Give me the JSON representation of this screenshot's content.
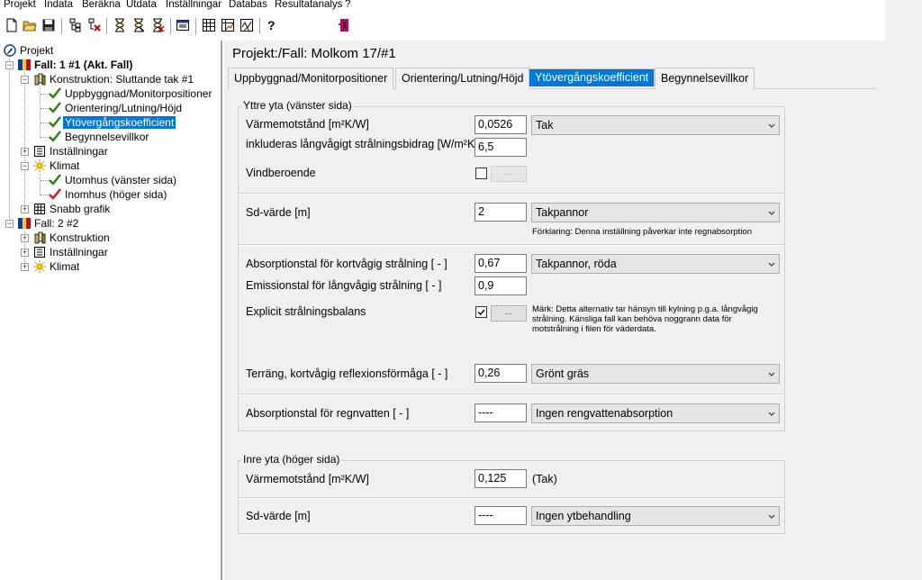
{
  "menu": [
    "Projekt",
    "Indata",
    "Beräkna",
    "Utdata",
    "Inställningar",
    "Databas",
    "Resultatanalys",
    "?"
  ],
  "toolbar": {
    "help_label": "?"
  },
  "tree": {
    "root": "Projekt",
    "case1": "Fall: 1 #1 (Akt. Fall)",
    "construction1": "Konstruktion: Sluttande tak #1",
    "construction1_items": [
      "Uppbyggnad/Monitorpositioner",
      "Orientering/Lutning/Höjd",
      "Ytövergångskoefficient",
      "Begynnelsevillkor"
    ],
    "settings1": "Inställningar",
    "climate1": "Klimat",
    "climate1_items": [
      "Utomhus (vänster sida)",
      "Inomhus (höger sida)"
    ],
    "quick_graph": "Snabb grafik",
    "case2": "Fall: 2 #2",
    "construction2": "Konstruktion",
    "settings2": "Inställningar",
    "climate2": "Klimat"
  },
  "pane": {
    "title": "Projekt:/Fall:  Molkom 17/#1",
    "tabs": [
      "Uppbyggnad/Monitorpositioner",
      "Orientering/Lutning/Höjd",
      "Ytövergångskoefficient",
      "Begynnelsevillkor"
    ]
  },
  "outer": {
    "group_label": "Yttre yta (vänster sida)",
    "thermal_resistance_label": "Värmemotstånd [m²K/W]",
    "thermal_resistance_value": "0,0526",
    "thermal_resistance_combo": "Tak",
    "longwave_label": "inkluderas långvågigt strålningsbidrag [W/m²K]",
    "longwave_value": "6,5",
    "wind_label": "Vindberoende",
    "wind_button": "...",
    "sd_label": "Sd-värde  [m]",
    "sd_value": "2",
    "sd_combo": "Takpannor",
    "sd_note": "Förklaring: Denna inställning påverkar inte regnabsorption",
    "absorption_label": "Absorptionstal för kortvågig strålning [ - ]",
    "absorption_value": "0,67",
    "absorption_combo": "Takpannor, röda",
    "emission_label": "Emissionstal för långvågig strålning [ - ]",
    "emission_value": "0,9",
    "explicit_label": "Explicit strålningsbalans",
    "explicit_button": "...",
    "explicit_note": "Märk: Detta alternativ tar hänsyn till kylning p.g.a. långvågig strålning. Känsliga fall kan behöva noggrann data för motstrålning i filen för väderdata.",
    "terrain_label": "Terräng, kortvågig reflexionsförmåga [ - ]",
    "terrain_value": "0,26",
    "terrain_combo": "Grönt gräs",
    "rain_label": "Absorptionstal för regnvatten [ - ]",
    "rain_value": "----",
    "rain_combo": "Ingen rengvattenabsorption"
  },
  "inner": {
    "group_label": "Inre yta (höger sida)",
    "thermal_resistance_label": "Värmemotstånd [m²K/W]",
    "thermal_resistance_value": "0,125",
    "thermal_resistance_text": "(Tak)",
    "sd_label": "Sd-värde  [m]",
    "sd_value": "----",
    "sd_combo": "Ingen ytbehandling"
  }
}
